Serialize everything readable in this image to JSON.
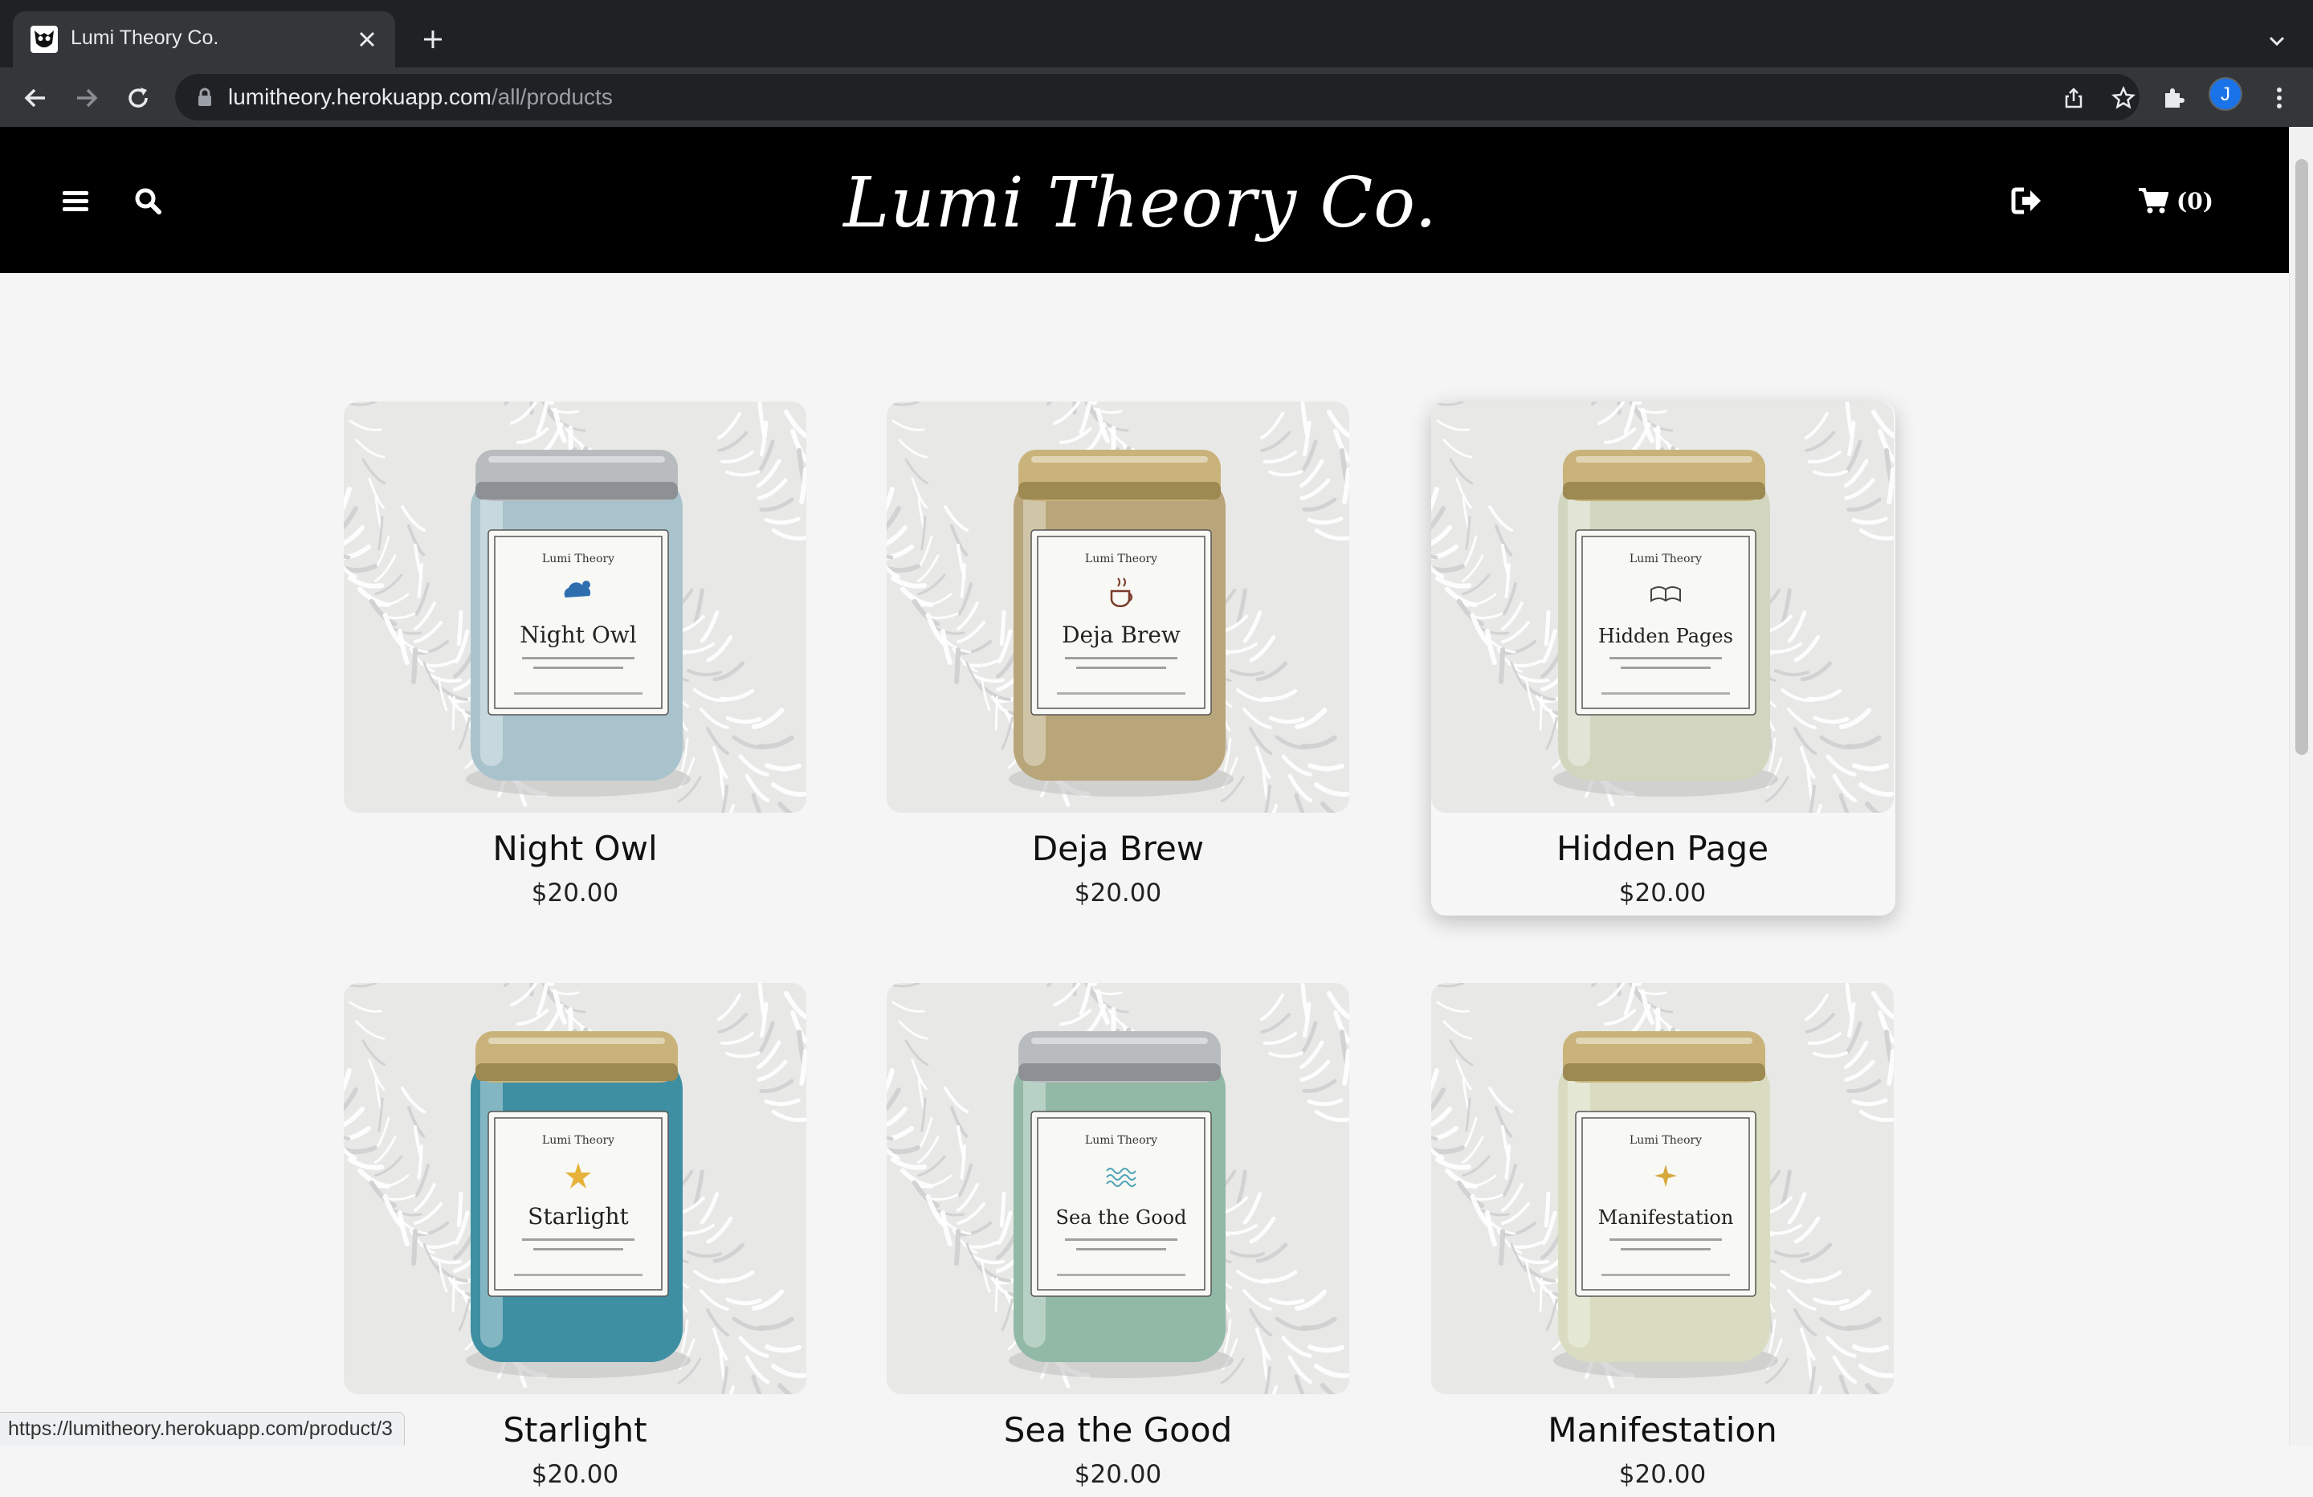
{
  "browser": {
    "tab_title": "Lumi Theory Co.",
    "url_host": "lumitheory.herokuapp.com",
    "url_path": "/all/products",
    "profile_initial": "J"
  },
  "site": {
    "logo": "Lumi Theory Co.",
    "cart_count": "(0)"
  },
  "products": [
    {
      "name": "Night Owl",
      "price": "$20.00",
      "jar_color": "#a9c3cc",
      "lid": "silver",
      "label_title": "Night Owl",
      "icon": "cloud-moon-icon"
    },
    {
      "name": "Deja Brew",
      "price": "$20.00",
      "jar_color": "#b8a67a",
      "lid": "gold",
      "label_title": "Deja Brew",
      "icon": "coffee-cup-icon"
    },
    {
      "name": "Hidden Page",
      "price": "$20.00",
      "jar_color": "#d3d6bf",
      "lid": "gold",
      "label_title": "Hidden Pages",
      "icon": "open-book-icon"
    },
    {
      "name": "Starlight",
      "price": "$20.00",
      "jar_color": "#3f8fa3",
      "lid": "gold",
      "label_title": "Starlight",
      "icon": "star-icon"
    },
    {
      "name": "Sea the Good",
      "price": "$20.00",
      "jar_color": "#92b8a6",
      "lid": "silver",
      "label_title": "Sea the Good",
      "icon": "waves-icon"
    },
    {
      "name": "Manifestation",
      "price": "$20.00",
      "jar_color": "#d9dcc0",
      "lid": "gold",
      "label_title": "Manifestation",
      "icon": "sparkle-icon"
    }
  ],
  "status_bar": {
    "hover_url": "https://lumitheory.herokuapp.com/product/3"
  }
}
